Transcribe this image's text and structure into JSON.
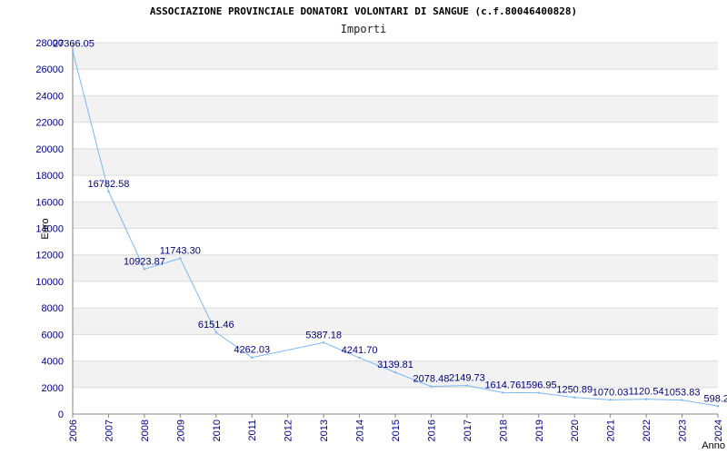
{
  "header": {
    "title": "ASSOCIAZIONE PROVINCIALE DONATORI VOLONTARI DI SANGUE (c.f.80046400828)",
    "subtitle": "Importi"
  },
  "chart_data": {
    "type": "line",
    "title": "ASSOCIAZIONE PROVINCIALE DONATORI VOLONTARI DI SANGUE (c.f.80046400828)",
    "subtitle": "Importi",
    "xlabel": "Anno",
    "ylabel": "Euro",
    "categories": [
      "2006",
      "2007",
      "2008",
      "2009",
      "2010",
      "2011",
      "2012",
      "2013",
      "2014",
      "2015",
      "2016",
      "2017",
      "2018",
      "2019",
      "2020",
      "2021",
      "2022",
      "2023",
      "2024"
    ],
    "values": [
      27366.05,
      16782.58,
      10923.87,
      11743.3,
      6151.46,
      4262.03,
      5387.18,
      4241.7,
      3139.81,
      2078.48,
      2149.73,
      1614.76,
      1596.95,
      1250.89,
      1070.03,
      1120.54,
      1053.83,
      598.2
    ],
    "x": [
      "2006",
      "2007",
      "2008",
      "2009",
      "2010",
      "2011",
      "2013",
      "2014",
      "2015",
      "2016",
      "2017",
      "2018",
      "2019",
      "2020",
      "2021",
      "2022",
      "2023",
      "2024"
    ],
    "data_labels": [
      "27366.05",
      "16782.58",
      "10923.87",
      "11743.30",
      "6151.46",
      "4262.03",
      "5387.18",
      "4241.70",
      "3139.81",
      "2078.48",
      "2149.73",
      "1614.76",
      "1596.95",
      "1250.89",
      "1070.03",
      "1120.54",
      "1053.83",
      "598.2"
    ],
    "y_ticks": [
      "0",
      "2000",
      "4000",
      "6000",
      "8000",
      "10000",
      "12000",
      "14000",
      "16000",
      "18000",
      "20000",
      "22000",
      "24000",
      "26000",
      "28000"
    ],
    "ylim": [
      0,
      28000
    ],
    "grid": true,
    "colors": {
      "line": "#7db7ef",
      "label": "#000080",
      "band": "#f2f2f2",
      "grid": "#dcdcdc"
    }
  }
}
